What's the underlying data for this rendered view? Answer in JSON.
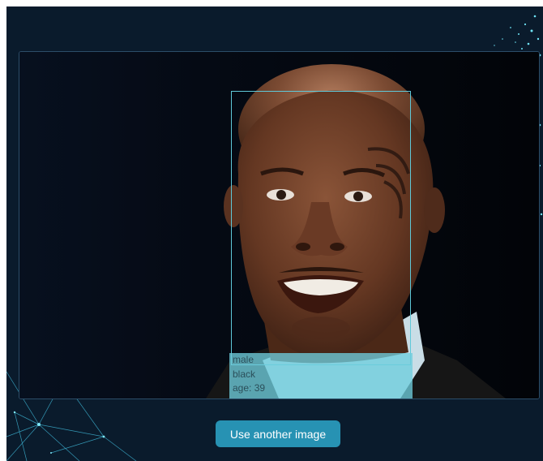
{
  "face_detection": {
    "attributes": [
      "male",
      "black",
      "age: 39"
    ]
  },
  "actions": {
    "use_another_label": "Use another image"
  },
  "colors": {
    "background": "#0a1b2c",
    "box_outline": "#5fc8d8",
    "label_panel": "#6ecddc",
    "button": "#2792b3"
  }
}
